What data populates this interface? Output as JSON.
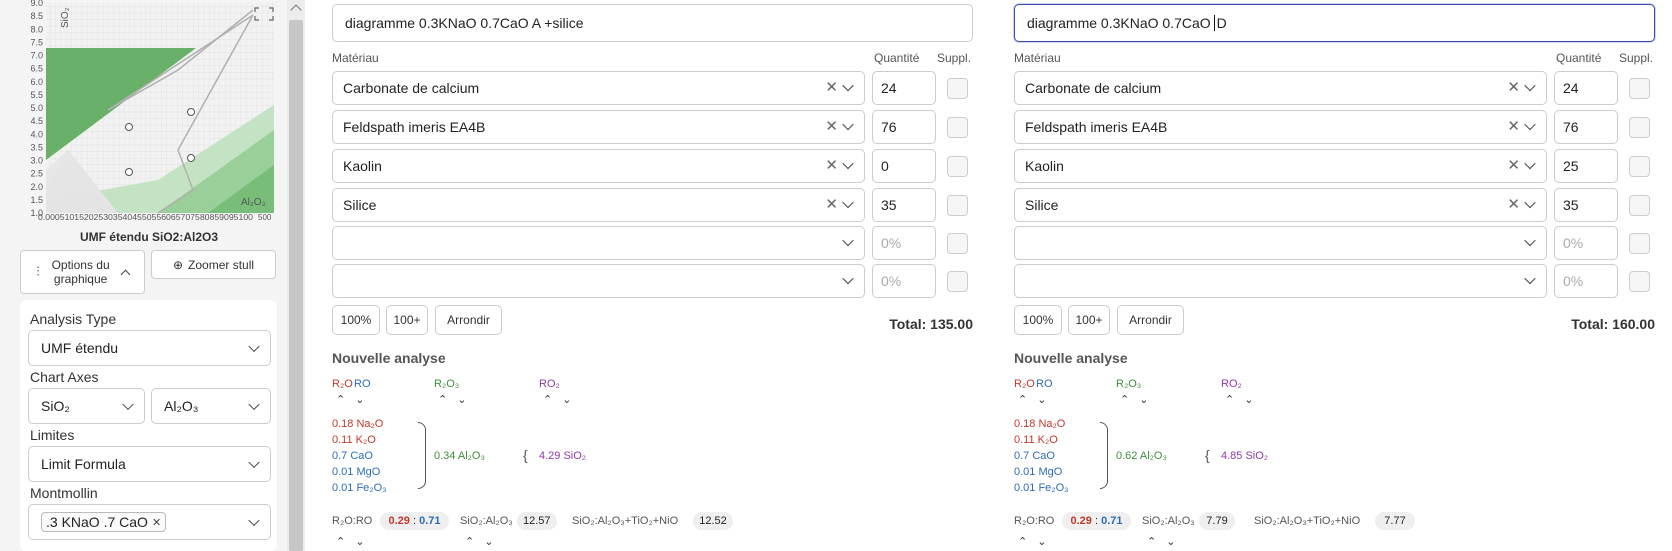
{
  "chart": {
    "ylabel": "SiO₂",
    "xlabel": "Al₂O₃",
    "y_ticks": [
      "1.0",
      "1.5",
      "2.0",
      "2.5",
      "3.0",
      "3.5",
      "4.0",
      "4.5",
      "5.0",
      "5.5",
      "6.0",
      "6.5",
      "7.0",
      "7.5",
      "8.0",
      "8.5",
      "9.0"
    ],
    "x_ticks": "0.0005101520253035404550556065707580859095100",
    "x_end": "500",
    "caption": "UMF étendu SiO2:Al2O3",
    "expand_icon": "expand-icon"
  },
  "sidebar": {
    "options_label": "Options du graphique",
    "zoom_label": "Zoomer stull",
    "analysis_type_label": "Analysis Type",
    "analysis_type_value": "UMF étendu",
    "chart_axes_label": "Chart Axes",
    "axis_x_value": "SiO₂",
    "axis_y_value": "Al₂O₃",
    "limites_label": "Limites",
    "limites_value": "Limit Formula",
    "montmollin_label": "Montmollin",
    "montmollin_tag": ".3 KNaO .7 CaO",
    "tag_remove": "✕"
  },
  "headers": {
    "material": "Matériau",
    "quantity": "Quantité",
    "suppl": "Suppl."
  },
  "buttons": {
    "b100": "100%",
    "b100plus": "100+",
    "round": "Arrondir"
  },
  "analysis_title": "Nouvelle analyse",
  "groups": {
    "r2o": "R₂O",
    "ro": "RO",
    "r2o3": "R₂O₃",
    "ro2": "RO₂"
  },
  "sort_arrows": "⌃⌄",
  "recipes": [
    {
      "title": "diagramme 0.3KNaO 0.7CaO A +silice",
      "title_suffix": "",
      "materials": [
        {
          "name": "Carbonate de calcium",
          "qty": "24"
        },
        {
          "name": "Feldspath imeris EA4B",
          "qty": "76"
        },
        {
          "name": "Kaolin",
          "qty": "0"
        },
        {
          "name": "Silice",
          "qty": "35"
        },
        {
          "name": "",
          "qty": "0%"
        },
        {
          "name": "",
          "qty": "0%"
        }
      ],
      "total": "Total: 135.00",
      "flux": [
        "0.18 Na₂O",
        "0.11 K₂O",
        "0.7 CaO",
        "0.01 MgO",
        "0.01 Fe₂O₃"
      ],
      "al2o3": "0.34 Al₂O₃",
      "sio2": "4.29 SiO₂",
      "ratio_label": "R₂O:RO",
      "ratio_r2o": "0.29",
      "ratio_ro": "0.71",
      "si_al_label": "SiO₂:Al₂O₃",
      "si_al": "12.57",
      "si_al_ti_label": "SiO₂:Al₂O₃+TiO₂+NiO",
      "si_al_ti": "12.52"
    },
    {
      "title": "diagramme 0.3KNaO 0.7CaO",
      "title_suffix": "D",
      "materials": [
        {
          "name": "Carbonate de calcium",
          "qty": "24"
        },
        {
          "name": "Feldspath imeris EA4B",
          "qty": "76"
        },
        {
          "name": "Kaolin",
          "qty": "25"
        },
        {
          "name": "Silice",
          "qty": "35"
        },
        {
          "name": "",
          "qty": "0%"
        },
        {
          "name": "",
          "qty": "0%"
        }
      ],
      "total": "Total: 160.00",
      "flux": [
        "0.18 Na₂O",
        "0.11 K₂O",
        "0.7 CaO",
        "0.01 MgO",
        "0.01 Fe₂O₃"
      ],
      "al2o3": "0.62 Al₂O₃",
      "sio2": "4.85 SiO₂",
      "ratio_label": "R₂O:RO",
      "ratio_r2o": "0.29",
      "ratio_ro": "0.71",
      "si_al_label": "SiO₂:Al₂O₃",
      "si_al": "7.79",
      "si_al_ti_label": "SiO₂:Al₂O₃+TiO₂+NiO",
      "si_al_ti": "7.77"
    }
  ],
  "colors": {
    "r2o": "#c0392b",
    "ro": "#2d6cb5",
    "r2o3": "#3f8f3b",
    "ro2": "#8e3aa6",
    "focus": "#3b4bb0"
  }
}
